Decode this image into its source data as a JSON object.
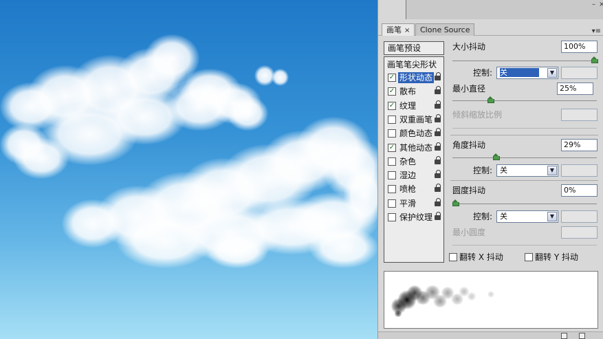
{
  "panel": {
    "tabs": [
      {
        "label": "画笔",
        "close": "×",
        "active": true
      },
      {
        "label": "Clone Source",
        "active": false
      }
    ],
    "window_controls": {
      "minimize": "–",
      "close": "×"
    },
    "menu_glyph": "▾≡",
    "preset_button": "画笔预设",
    "list_header": "画笔笔尖形状",
    "items": [
      {
        "label": "形状动态",
        "checked": true,
        "selected": true
      },
      {
        "label": "散布",
        "checked": true
      },
      {
        "label": "纹理",
        "checked": true
      },
      {
        "label": "双重画笔",
        "checked": false
      },
      {
        "label": "颜色动态",
        "checked": false
      },
      {
        "label": "其他动态",
        "checked": true
      },
      {
        "label": "杂色",
        "checked": false
      },
      {
        "label": "湿边",
        "checked": false
      },
      {
        "label": "喷枪",
        "checked": false
      },
      {
        "label": "平滑",
        "checked": false
      },
      {
        "label": "保护纹理",
        "checked": false
      }
    ],
    "check_glyph": "✓",
    "settings": {
      "size_jitter": {
        "label": "大小抖动",
        "value": "100%",
        "level": 1.0
      },
      "size_control": {
        "label": "控制:",
        "value": "关"
      },
      "min_diameter": {
        "label": "最小直径",
        "value": "25%",
        "level": 0.25
      },
      "tilt_scale": {
        "label": "倾斜缩放比例"
      },
      "angle_jitter": {
        "label": "角度抖动",
        "value": "29%",
        "level": 0.29
      },
      "angle_control": {
        "label": "控制:",
        "value": "关"
      },
      "roundness_jitter": {
        "label": "圆度抖动",
        "value": "0%",
        "level": 0.0
      },
      "roundness_control": {
        "label": "控制:",
        "value": "关"
      },
      "min_roundness": {
        "label": "最小圆度"
      },
      "flip_x": {
        "label": "翻转 X 抖动",
        "checked": false
      },
      "flip_y": {
        "label": "翻转 Y 抖动",
        "checked": false
      }
    }
  },
  "colors": {
    "selection": "#2d62b8",
    "check": "#1a6b1a",
    "slider_thumb": "#4e9a4e"
  }
}
